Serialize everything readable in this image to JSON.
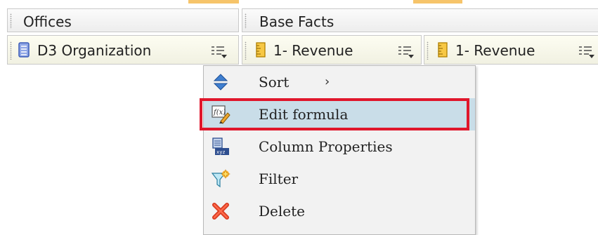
{
  "header": {
    "groups": [
      {
        "label": "Offices"
      },
      {
        "label": "Base Facts"
      }
    ]
  },
  "columns": [
    {
      "label": "D3 Organization",
      "icon": "dimension-table-icon"
    },
    {
      "label": "1- Revenue",
      "icon": "measure-icon"
    },
    {
      "label": "1- Revenue",
      "icon": "measure-icon"
    }
  ],
  "context_menu": {
    "items": [
      {
        "label": "Sort",
        "icon": "sort-updown-icon",
        "has_submenu": true,
        "arrow": "›"
      },
      {
        "label": "Edit formula",
        "icon": "edit-formula-icon",
        "highlighted": true
      },
      {
        "label": "Column Properties",
        "icon": "column-properties-icon"
      },
      {
        "label": "Filter",
        "icon": "filter-icon"
      },
      {
        "label": "Delete",
        "icon": "delete-icon"
      }
    ]
  },
  "colors": {
    "highlight_outline": "#e0162b",
    "menu_hover": "#c9dde8",
    "top_accent": "#f6c46a"
  }
}
